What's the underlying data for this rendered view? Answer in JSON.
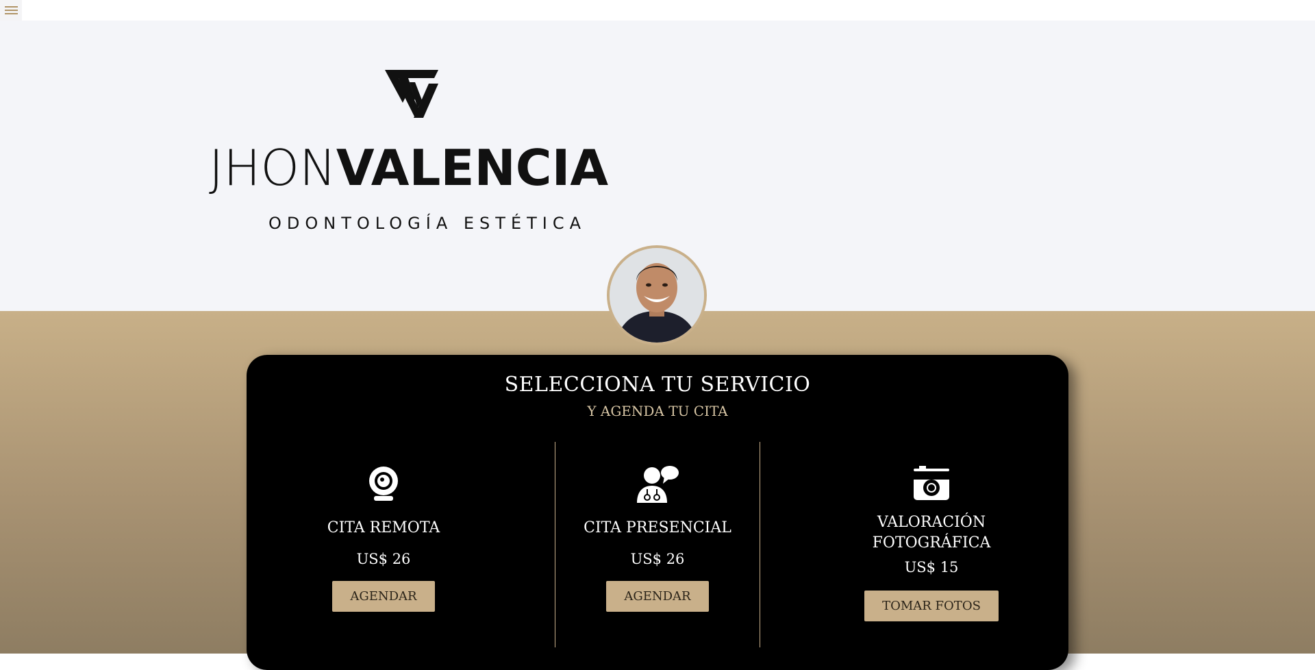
{
  "nav": {
    "menu_icon": "hamburger-icon"
  },
  "brand": {
    "name_light": "JHON",
    "name_bold": "VALENCIA",
    "tagline": "ODONTOLOGÍA ESTÉTICA",
    "logo_icon": "jv-monogram-logo"
  },
  "avatar": {
    "icon": "profile-photo"
  },
  "services_card": {
    "title": "SELECCIONA TU SERVICIO",
    "subtitle": "Y AGENDA TU CITA",
    "services": [
      {
        "icon": "webcam-icon",
        "name": "CITA REMOTA",
        "price": "US$ 26",
        "button": "AGENDAR"
      },
      {
        "icon": "doctor-chat-icon",
        "name": "CITA PRESENCIAL",
        "price": "US$ 26",
        "button": "AGENDAR"
      },
      {
        "icon": "camera-icon",
        "name_line1": "VALORACIÓN",
        "name_line2": "FOTOGRÁFICA",
        "price": "US$ 15",
        "button": "TOMAR FOTOS"
      }
    ]
  },
  "colors": {
    "accent_gold": "#c9b08a",
    "hero_bg": "#f4f5f9",
    "card_bg": "#000000"
  }
}
